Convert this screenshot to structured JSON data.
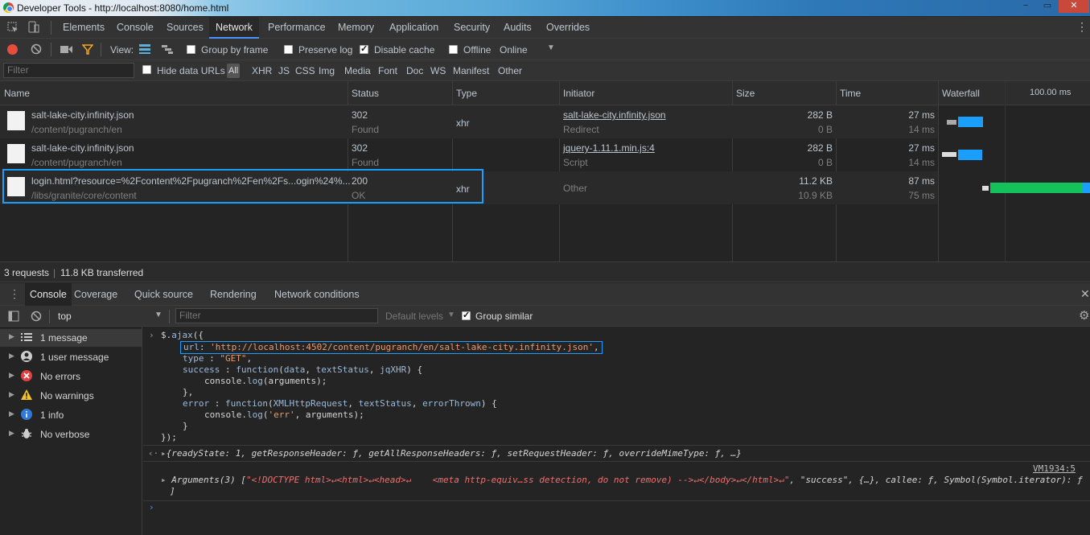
{
  "window": {
    "title": "Developer Tools - http://localhost:8080/home.html",
    "controls": [
      "−",
      "▭",
      "✕"
    ]
  },
  "tabs": [
    {
      "label": "Elements"
    },
    {
      "label": "Console"
    },
    {
      "label": "Sources"
    },
    {
      "label": "Network",
      "selected": true
    },
    {
      "label": "Performance"
    },
    {
      "label": "Memory"
    },
    {
      "label": "Application"
    },
    {
      "label": "Security"
    },
    {
      "label": "Audits"
    },
    {
      "label": "Overrides"
    }
  ],
  "network_toolbar": {
    "view_label": "View:",
    "group_by_frame": "Group by frame",
    "preserve_log": "Preserve log",
    "disable_cache": "Disable cache",
    "offline": "Offline",
    "throttle": "Online"
  },
  "filter_bar": {
    "placeholder": "Filter",
    "hide_data_urls": "Hide data URLs",
    "types": [
      "All",
      "XHR",
      "JS",
      "CSS",
      "Img",
      "Media",
      "Font",
      "Doc",
      "WS",
      "Manifest",
      "Other"
    ]
  },
  "columns": {
    "name": "Name",
    "status": "Status",
    "type": "Type",
    "initiator": "Initiator",
    "size": "Size",
    "time": "Time",
    "waterfall": "Waterfall",
    "scale": "100.00 ms"
  },
  "requests": [
    {
      "name": "salt-lake-city.infinity.json",
      "path": "/content/pugranch/en",
      "status": "302",
      "status_text": "Found",
      "type": "xhr",
      "initiator": "salt-lake-city.infinity.json",
      "initiator_sub": "Redirect",
      "size": "282 B",
      "size_sub": "0 B",
      "time": "27 ms",
      "time_sub": "14 ms"
    },
    {
      "name": "salt-lake-city.infinity.json",
      "path": "/content/pugranch/en",
      "status": "302",
      "status_text": "Found",
      "type": "",
      "initiator": "jquery-1.11.1.min.js:4",
      "initiator_sub": "Script",
      "size": "282 B",
      "size_sub": "0 B",
      "time": "27 ms",
      "time_sub": "14 ms"
    },
    {
      "name": "login.html?resource=%2Fcontent%2Fpugranch%2Fen%2Fs...ogin%24%...",
      "path": "/libs/granite/core/content",
      "status": "200",
      "status_text": "OK",
      "type": "xhr",
      "initiator": "Other",
      "initiator_sub": "",
      "size": "11.2 KB",
      "size_sub": "10.9 KB",
      "time": "87 ms",
      "time_sub": "75 ms"
    }
  ],
  "summary": {
    "requests": "3 requests",
    "transferred": "11.8 KB transferred"
  },
  "drawer_tabs": [
    "Console",
    "Coverage",
    "Quick source",
    "Rendering",
    "Network conditions"
  ],
  "console_toolbar": {
    "context": "top",
    "filter_placeholder": "Filter",
    "levels": "Default levels",
    "group_similar": "Group similar"
  },
  "sidebar": [
    {
      "label": "1 message",
      "icon": "list-icon"
    },
    {
      "label": "1 user message",
      "icon": "user-icon"
    },
    {
      "label": "No errors",
      "icon": "error-icon"
    },
    {
      "label": "No warnings",
      "icon": "warning-icon"
    },
    {
      "label": "1 info",
      "icon": "info-icon"
    },
    {
      "label": "No verbose",
      "icon": "bug-icon"
    }
  ],
  "console": {
    "lines": [
      "$.ajax({",
      "url: 'http://localhost:4502/content/pugranch/en/salt-lake-city.infinity.json',",
      "type : \"GET\",",
      "success : function(data, textStatus, jqXHR) {",
      "console.log(arguments);",
      "},",
      "error : function(XMLHttpRequest, textStatus, errorThrown) {",
      "console.log('err', arguments);",
      "}",
      "});"
    ],
    "result": "{readyState: 1, getResponseHeader: ƒ, getAllResponseHeaders: ƒ, setRequestHeader: ƒ, overrideMimeType: ƒ, …}",
    "log_source": "VM1934:5",
    "log_prefix": "Arguments(3) [",
    "log_html": "\"<!DOCTYPE html>↵<html>↵<head>↵    <meta http-equiv…ss detection, do not remove) -->↵</body>↵</html>↵\"",
    "log_rest": ", \"success\", {…}, callee: ƒ, Symbol(Symbol.iterator): ƒ",
    "log_close": "]"
  },
  "colors": {
    "accent": "#4d90fe",
    "highlight": "#1a9fff",
    "waterfall_blue": "#1a9fff",
    "waterfall_green": "#13c25b"
  }
}
